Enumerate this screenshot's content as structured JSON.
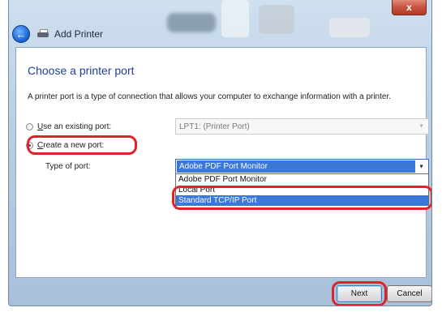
{
  "window": {
    "title": "Add Printer",
    "close_label": "x"
  },
  "page": {
    "heading": "Choose a printer port",
    "description": "A printer port is a type of connection that allows your computer to exchange information with a printer."
  },
  "options": {
    "existing": {
      "prefix": "",
      "underline": "U",
      "rest": "se an existing port:",
      "selected": false
    },
    "new": {
      "prefix": "",
      "underline": "C",
      "rest": "reate a new port:",
      "selected": true
    }
  },
  "existing_port": {
    "value": "LPT1: (Printer Port)"
  },
  "type_of_port": {
    "label": "Type of port:",
    "value": "Adobe PDF Port Monitor",
    "options": [
      "Adobe PDF Port Monitor",
      "Local Port",
      "Standard TCP/IP Port"
    ],
    "highlighted_index": 2
  },
  "buttons": {
    "next": "Next",
    "cancel": "Cancel"
  },
  "icons": {
    "back": "back-arrow-icon",
    "printer": "printer-icon",
    "dropdown": "chevron-down-icon"
  },
  "colors": {
    "heading": "#1f3d99",
    "selection": "#3a78d6",
    "annotation": "#e0222b",
    "close_button": "#c75340"
  }
}
